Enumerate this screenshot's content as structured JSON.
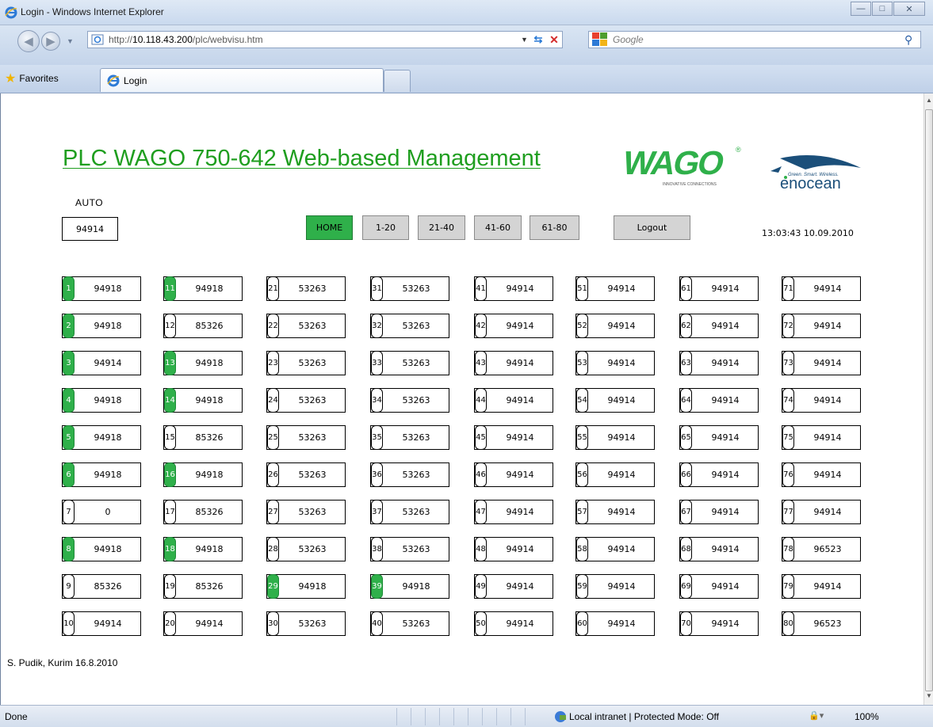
{
  "window": {
    "title": "Login - Windows Internet Explorer",
    "minimize_glyph": "—",
    "maximize_glyph": "□",
    "close_glyph": "✕"
  },
  "addressbar": {
    "url_prefix": "http://",
    "url_host": "10.118.43.200",
    "url_path": "/plc/webvisu.htm",
    "search_placeholder": "Google"
  },
  "tabsbar": {
    "favorites_label": "Favorites",
    "tab_label": "Login"
  },
  "page": {
    "title": "PLC WAGO 750-642 Web-based Management",
    "wago_logo_text": "WAGO",
    "wago_tagline": "INNOVATIVE CONNECTIONS",
    "enocean_tagline": "Green. Smart. Wireless.",
    "enocean_logo_text": "enocean",
    "auto_label": "AUTO",
    "auto_value": "94914",
    "datetime": "13:03:43  10.09.2010",
    "footer_note": "S. Pudik, Kurim 16.8.2010",
    "nav": [
      {
        "label": "HOME",
        "active": true
      },
      {
        "label": "1-20",
        "active": false
      },
      {
        "label": "21-40",
        "active": false
      },
      {
        "label": "41-60",
        "active": false
      },
      {
        "label": "61-80",
        "active": false
      },
      {
        "label": "Logout",
        "active": false
      }
    ],
    "cells": [
      {
        "n": "1",
        "v": "94918",
        "on": true
      },
      {
        "n": "2",
        "v": "94918",
        "on": true
      },
      {
        "n": "3",
        "v": "94914",
        "on": true
      },
      {
        "n": "4",
        "v": "94918",
        "on": true
      },
      {
        "n": "5",
        "v": "94918",
        "on": true
      },
      {
        "n": "6",
        "v": "94918",
        "on": true
      },
      {
        "n": "7",
        "v": "0",
        "on": false
      },
      {
        "n": "8",
        "v": "94918",
        "on": true
      },
      {
        "n": "9",
        "v": "85326",
        "on": false
      },
      {
        "n": "10",
        "v": "94914",
        "on": false
      },
      {
        "n": "11",
        "v": "94918",
        "on": true
      },
      {
        "n": "12",
        "v": "85326",
        "on": false
      },
      {
        "n": "13",
        "v": "94918",
        "on": true
      },
      {
        "n": "14",
        "v": "94918",
        "on": true
      },
      {
        "n": "15",
        "v": "85326",
        "on": false
      },
      {
        "n": "16",
        "v": "94918",
        "on": true
      },
      {
        "n": "17",
        "v": "85326",
        "on": false
      },
      {
        "n": "18",
        "v": "94918",
        "on": true
      },
      {
        "n": "19",
        "v": "85326",
        "on": false
      },
      {
        "n": "20",
        "v": "94914",
        "on": false
      },
      {
        "n": "21",
        "v": "53263",
        "on": false
      },
      {
        "n": "22",
        "v": "53263",
        "on": false
      },
      {
        "n": "23",
        "v": "53263",
        "on": false
      },
      {
        "n": "24",
        "v": "53263",
        "on": false
      },
      {
        "n": "25",
        "v": "53263",
        "on": false
      },
      {
        "n": "26",
        "v": "53263",
        "on": false
      },
      {
        "n": "27",
        "v": "53263",
        "on": false
      },
      {
        "n": "28",
        "v": "53263",
        "on": false
      },
      {
        "n": "29",
        "v": "94918",
        "on": true
      },
      {
        "n": "30",
        "v": "53263",
        "on": false
      },
      {
        "n": "31",
        "v": "53263",
        "on": false
      },
      {
        "n": "32",
        "v": "53263",
        "on": false
      },
      {
        "n": "33",
        "v": "53263",
        "on": false
      },
      {
        "n": "34",
        "v": "53263",
        "on": false
      },
      {
        "n": "35",
        "v": "53263",
        "on": false
      },
      {
        "n": "36",
        "v": "53263",
        "on": false
      },
      {
        "n": "37",
        "v": "53263",
        "on": false
      },
      {
        "n": "38",
        "v": "53263",
        "on": false
      },
      {
        "n": "39",
        "v": "94918",
        "on": true
      },
      {
        "n": "40",
        "v": "53263",
        "on": false
      },
      {
        "n": "41",
        "v": "94914",
        "on": false
      },
      {
        "n": "42",
        "v": "94914",
        "on": false
      },
      {
        "n": "43",
        "v": "94914",
        "on": false
      },
      {
        "n": "44",
        "v": "94914",
        "on": false
      },
      {
        "n": "45",
        "v": "94914",
        "on": false
      },
      {
        "n": "46",
        "v": "94914",
        "on": false
      },
      {
        "n": "47",
        "v": "94914",
        "on": false
      },
      {
        "n": "48",
        "v": "94914",
        "on": false
      },
      {
        "n": "49",
        "v": "94914",
        "on": false
      },
      {
        "n": "50",
        "v": "94914",
        "on": false
      },
      {
        "n": "51",
        "v": "94914",
        "on": false
      },
      {
        "n": "52",
        "v": "94914",
        "on": false
      },
      {
        "n": "53",
        "v": "94914",
        "on": false
      },
      {
        "n": "54",
        "v": "94914",
        "on": false
      },
      {
        "n": "55",
        "v": "94914",
        "on": false
      },
      {
        "n": "56",
        "v": "94914",
        "on": false
      },
      {
        "n": "57",
        "v": "94914",
        "on": false
      },
      {
        "n": "58",
        "v": "94914",
        "on": false
      },
      {
        "n": "59",
        "v": "94914",
        "on": false
      },
      {
        "n": "60",
        "v": "94914",
        "on": false
      },
      {
        "n": "61",
        "v": "94914",
        "on": false
      },
      {
        "n": "62",
        "v": "94914",
        "on": false
      },
      {
        "n": "63",
        "v": "94914",
        "on": false
      },
      {
        "n": "64",
        "v": "94914",
        "on": false
      },
      {
        "n": "65",
        "v": "94914",
        "on": false
      },
      {
        "n": "66",
        "v": "94914",
        "on": false
      },
      {
        "n": "67",
        "v": "94914",
        "on": false
      },
      {
        "n": "68",
        "v": "94914",
        "on": false
      },
      {
        "n": "69",
        "v": "94914",
        "on": false
      },
      {
        "n": "70",
        "v": "94914",
        "on": false
      },
      {
        "n": "71",
        "v": "94914",
        "on": false
      },
      {
        "n": "72",
        "v": "94914",
        "on": false
      },
      {
        "n": "73",
        "v": "94914",
        "on": false
      },
      {
        "n": "74",
        "v": "94914",
        "on": false
      },
      {
        "n": "75",
        "v": "94914",
        "on": false
      },
      {
        "n": "76",
        "v": "94914",
        "on": false
      },
      {
        "n": "77",
        "v": "94914",
        "on": false
      },
      {
        "n": "78",
        "v": "96523",
        "on": false
      },
      {
        "n": "79",
        "v": "94914",
        "on": false
      },
      {
        "n": "80",
        "v": "96523",
        "on": false
      }
    ]
  },
  "statusbar": {
    "status_text": "Done",
    "zone_text": "Local intranet | Protected Mode: Off",
    "zoom_text": "100%"
  },
  "colors": {
    "active_green": "#2fb04a",
    "title_green": "#1f9e1f",
    "button_gray": "#d4d4d4"
  }
}
